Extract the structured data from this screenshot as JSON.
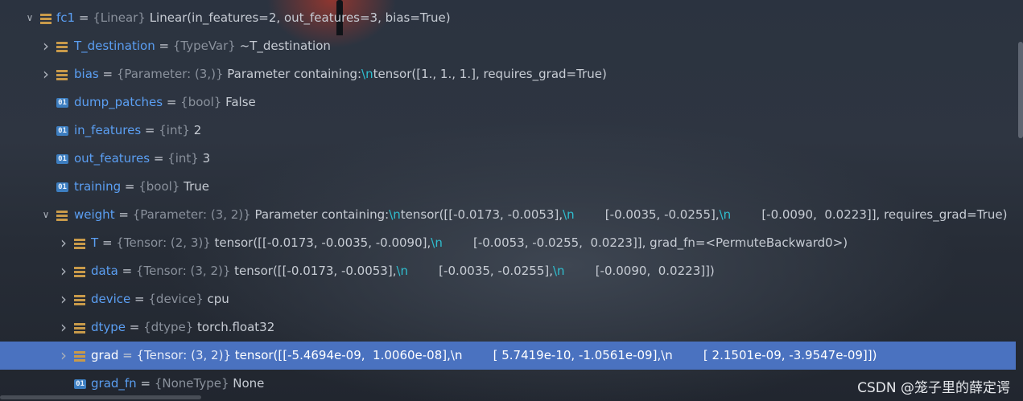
{
  "rows": [
    {
      "indent": 0,
      "arrow": "v",
      "icon": "field",
      "name": "fc1",
      "type": "{Linear}",
      "value": "Linear(in_features=2, out_features=3, bias=True)"
    },
    {
      "indent": 1,
      "arrow": ">",
      "icon": "field",
      "name": "T_destination",
      "type": "{TypeVar}",
      "value": "~T_destination"
    },
    {
      "indent": 1,
      "arrow": ">",
      "icon": "field",
      "name": "bias",
      "type": "{Parameter: (3,)}",
      "value": "Parameter containing:\\ntensor([1., 1., 1.], requires_grad=True)"
    },
    {
      "indent": 1,
      "arrow": "",
      "icon": "prim",
      "name": "dump_patches",
      "type": "{bool}",
      "value": "False"
    },
    {
      "indent": 1,
      "arrow": "",
      "icon": "prim",
      "name": "in_features",
      "type": "{int}",
      "value": "2"
    },
    {
      "indent": 1,
      "arrow": "",
      "icon": "prim",
      "name": "out_features",
      "type": "{int}",
      "value": "3"
    },
    {
      "indent": 1,
      "arrow": "",
      "icon": "prim",
      "name": "training",
      "type": "{bool}",
      "value": "True"
    },
    {
      "indent": 1,
      "arrow": "v",
      "icon": "field",
      "name": "weight",
      "type": "{Parameter: (3, 2)}",
      "value": "Parameter containing:\\ntensor([[-0.0173, -0.0053],\\n        [-0.0035, -0.0255],\\n        [-0.0090,  0.0223]], requires_grad=True)"
    },
    {
      "indent": 2,
      "arrow": ">",
      "icon": "field",
      "name": "T",
      "type": "{Tensor: (2, 3)}",
      "value": "tensor([[-0.0173, -0.0035, -0.0090],\\n        [-0.0053, -0.0255,  0.0223]], grad_fn=<PermuteBackward0>)"
    },
    {
      "indent": 2,
      "arrow": ">",
      "icon": "field",
      "name": "data",
      "type": "{Tensor: (3, 2)}",
      "value": "tensor([[-0.0173, -0.0053],\\n        [-0.0035, -0.0255],\\n        [-0.0090,  0.0223]])"
    },
    {
      "indent": 2,
      "arrow": ">",
      "icon": "field",
      "name": "device",
      "type": "{device}",
      "value": "cpu"
    },
    {
      "indent": 2,
      "arrow": ">",
      "icon": "field",
      "name": "dtype",
      "type": "{dtype}",
      "value": "torch.float32"
    },
    {
      "indent": 2,
      "arrow": ">",
      "icon": "field",
      "name": "grad",
      "type": "{Tensor: (3, 2)}",
      "value": "tensor([[-5.4694e-09,  1.0060e-08],\\n        [ 5.7419e-10, -1.0561e-09],\\n        [ 2.1501e-09, -3.9547e-09]])",
      "selected": true
    },
    {
      "indent": 2,
      "arrow": "",
      "icon": "prim",
      "name": "grad_fn",
      "type": "{NoneType}",
      "value": "None"
    }
  ],
  "icon_labels": {
    "prim": "01"
  },
  "arrow_glyphs": {
    "v": "∨",
    ">": "›"
  },
  "icon_names": {
    "field": "field-icon",
    "prim": "primitive-icon"
  },
  "watermark": "CSDN @笼子里的薛定谔",
  "colors": {
    "name": "#5b9ff3",
    "type": "#8a919c",
    "selected_row": "#4a72c0",
    "escape": "#2fbfd0"
  }
}
